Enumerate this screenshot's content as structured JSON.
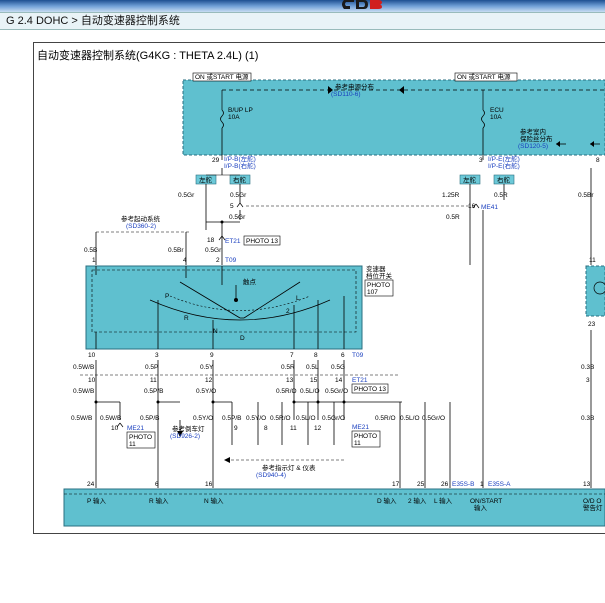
{
  "header": {
    "breadcrumb": "G 2.4 DOHC > 自动变速器控制系统",
    "logo_colors": {
      "left": "#1a1a1a",
      "right": "#d0201e"
    }
  },
  "diagram": {
    "title": "自动变速器控制系统(G4KG : THETA 2.4L) (1)",
    "on_start_left": "ON 或START 电源",
    "on_start_right": "ON 或START 电源",
    "ref_power_dist": "参考电源分布",
    "ref_power_dist_code": "(SD110-6)",
    "fuse_bup": "B/UP LP",
    "fuse_bup_amp": "10A",
    "fuse_ecu": "ECU",
    "fuse_ecu_amp": "10A",
    "ref_interior": "参考室内",
    "ref_interior2": "保险丝分布",
    "ref_interior_code": "(SD120-5)",
    "conn_29": "29",
    "ipb_l1": "I/P-B(左舵)",
    "ipb_l2": "I/P-B(右舵)",
    "conn_3": "3",
    "ipe_l1": "I/P-E(左舵)",
    "ipe_l2": "I/P-E(右舵)",
    "conn_8": "8",
    "box_left_1": "左舵",
    "box_right_1": "右舵",
    "box_left_2": "左舵",
    "box_right_2": "右舵",
    "w_05gr_a": "0.5Gr",
    "w_05gr_b": "0.5Gr",
    "w_05gr_c": "0.5Gr",
    "pin_5": "5",
    "w_125r": "1.25R",
    "w_05r_a": "0.5R",
    "pin_16a": "16",
    "me41": "ME41",
    "w_05r_b": "0.5R",
    "w_05br": "0.5Br",
    "ref_start": "参考起动系统",
    "ref_start_code": "(SD360-2)",
    "pin_18": "18",
    "et21_a": "ET21",
    "photo13_a": "PHOTO 13",
    "w_05b": "0.5B",
    "w_05br_b": "0.5Br",
    "w_05gr_d": "0.5Gr",
    "pin_1": "1",
    "pin_4": "4",
    "pin_2": "2",
    "t09_a": "T09",
    "pin_11r": "11",
    "pin_23r": "23",
    "switch_title1": "变速器",
    "switch_title2": "档位开关",
    "switch_photo1": "PHOTO",
    "switch_photo2": "107",
    "contact_label": "触点",
    "lbl_P": "P",
    "lbl_R": "R",
    "lbl_N": "N",
    "lbl_D": "D",
    "lbl_2": "2",
    "lbl_L": "L",
    "pin_10": "10",
    "pin_3": "3",
    "pin_9": "9",
    "pin_7": "7",
    "pin_8": "8",
    "pin_6": "6",
    "t09_b": "T09",
    "w_05wb_a": "0.5W/B",
    "w_05p_a": "0.5P",
    "w_05y_a": "0.5Y",
    "w_05r_c": "0.5R",
    "w_05l_a": "0.5L",
    "w_05g_a": "0.5G",
    "w_038_a": "0.3B",
    "c10": "10",
    "c11": "11",
    "c12": "12",
    "c13": "13",
    "c15": "15",
    "c14": "14",
    "et21_b": "ET21",
    "photo13_b": "PHOTO 13",
    "c3r": "3",
    "w_05wb_b": "0.5W/B",
    "w_05pb_a": "0.5P/B",
    "w_05yo_a": "0.5Y/O",
    "w_05ro_a": "0.5R/O",
    "w_05lo_a": "0.5L/O",
    "w_05gro_a": "0.5Gr/O",
    "w_05wb_c": "0.5W/B",
    "w_05wb_d": "0.5W/B",
    "w_05pb_b": "0.5P/B",
    "w_05yo_b": "0.5Y/O",
    "w_05pb_c": "0.5P/B",
    "w_05yo_c": "0.5Y/O",
    "w_05ro_b": "0.5R/O",
    "w_05lo_b": "0.5L/O",
    "w_05gro_b": "0.5Gr/O",
    "w_05ro_c": "0.5R/O",
    "w_05lo_c": "0.5L/O",
    "w_05gro_c": "0.5Gr/O",
    "w_038_b": "0.3B",
    "me21_a": "ME21",
    "photo11_a1": "PHOTO",
    "photo11_a2": "11",
    "pin_10b": "10",
    "ref_reverse": "参考倒车灯",
    "ref_reverse_code": "(SD926-2)",
    "pin_9b": "9",
    "pin_8b": "8",
    "pin_11b": "11",
    "pin_12b": "12",
    "me21_b": "ME21",
    "photo11_b1": "PHOTO",
    "photo11_b2": "11",
    "ref_indicator": "参考指示灯 & 仪表",
    "ref_indicator_code": "(SD940-4)",
    "pin_24": "24",
    "pin_6b": "6",
    "pin_16b": "16",
    "pin_17": "17",
    "pin_25": "25",
    "pin_26": "26",
    "e35sb": "E35S-B",
    "pin_1b": "1",
    "e35sa": "E35S-A",
    "pin_13": "13",
    "in_p": "P 输入",
    "in_r": "R 输入",
    "in_n": "N 输入",
    "in_d": "D 输入",
    "in_2": "2 输入",
    "in_l": "L 输入",
    "in_onstart1": "ON/START",
    "in_onstart2": "输入",
    "in_od1": "O/D O",
    "in_od2": "警告灯"
  },
  "colors": {
    "module_fill": "#5fc0cf",
    "module_border": "#2a6f80",
    "box_fill": "#6cc9d8",
    "link_blue": "#1a3fbf"
  }
}
